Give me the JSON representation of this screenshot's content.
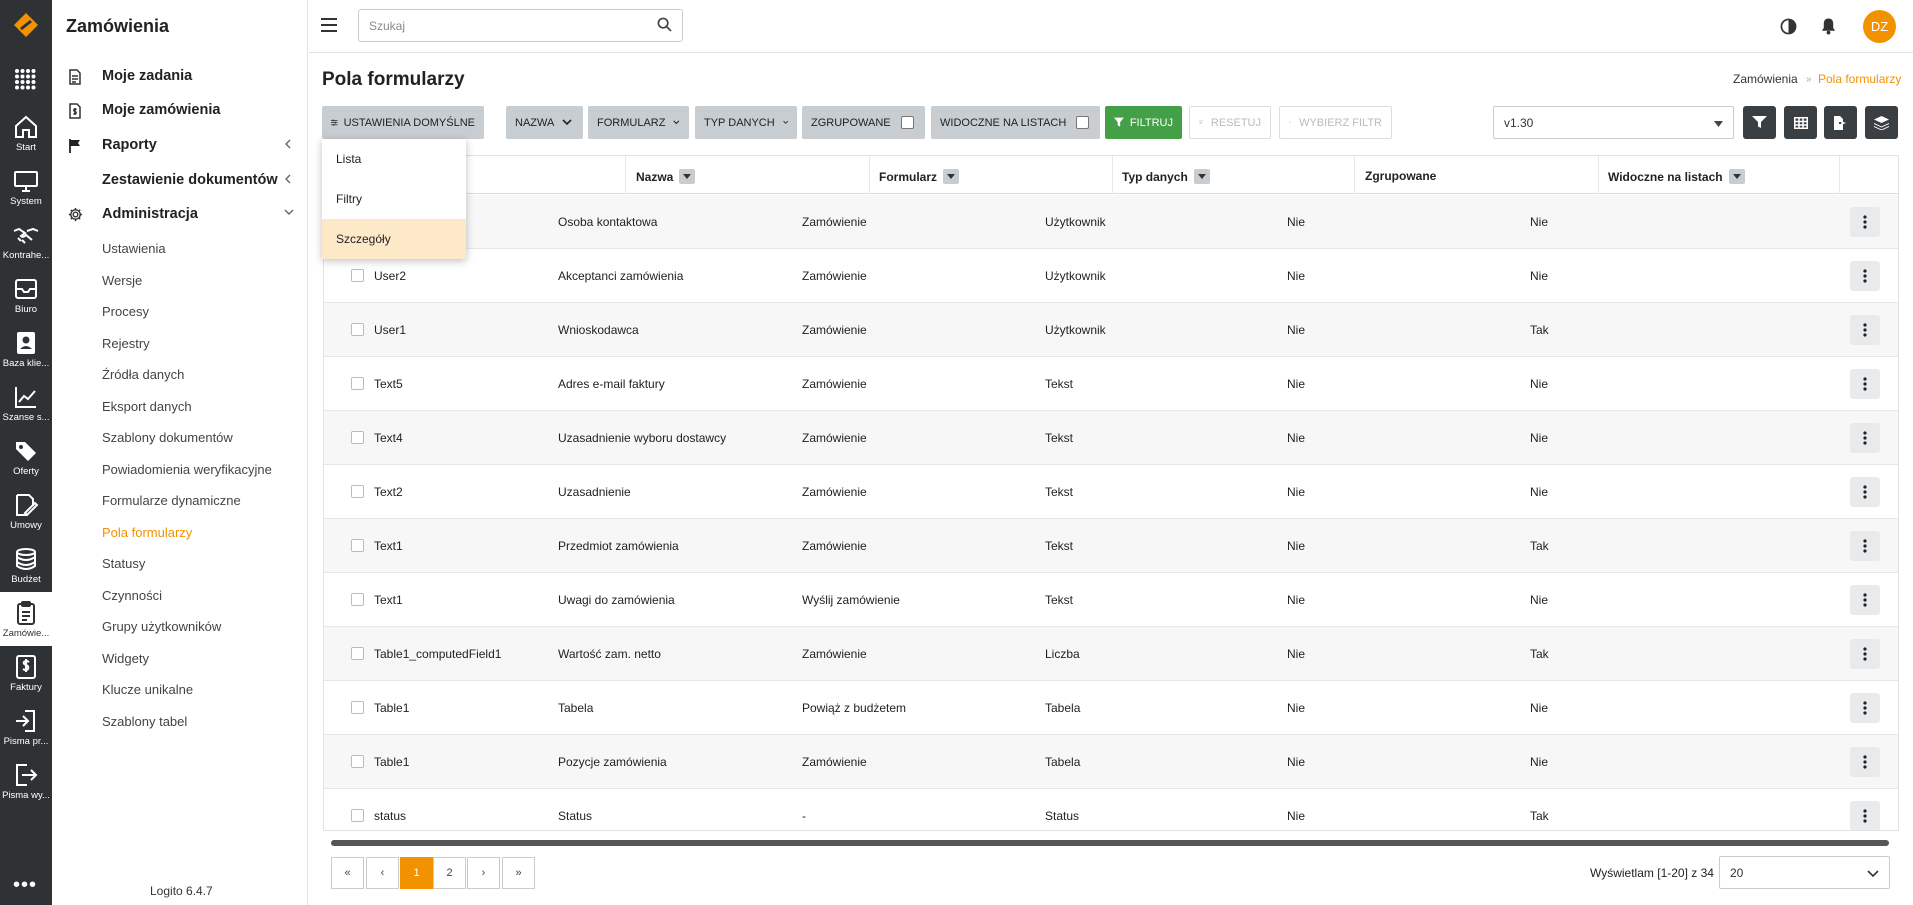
{
  "rail": {
    "items": [
      {
        "label": "Start",
        "icon": "home-icon"
      },
      {
        "label": "System",
        "icon": "monitor-icon"
      },
      {
        "label": "Kontrahe...",
        "icon": "handshake-icon"
      },
      {
        "label": "Biuro",
        "icon": "inbox-icon"
      },
      {
        "label": "Baza klie...",
        "icon": "contact-card-icon"
      },
      {
        "label": "Szanse s...",
        "icon": "chart-line-icon"
      },
      {
        "label": "Oferty",
        "icon": "tags-icon"
      },
      {
        "label": "Umowy",
        "icon": "signature-icon"
      },
      {
        "label": "Budżet",
        "icon": "coins-icon"
      },
      {
        "label": "Zamówie...",
        "icon": "clipboard-icon"
      },
      {
        "label": "Faktury",
        "icon": "invoice-icon"
      },
      {
        "label": "Pisma pr...",
        "icon": "sign-in-icon"
      },
      {
        "label": "Pisma wy...",
        "icon": "sign-out-icon"
      }
    ],
    "more": "•••"
  },
  "sidebar": {
    "title": "Zamówienia",
    "main": [
      {
        "label": "Moje zadania"
      },
      {
        "label": "Moje zamówienia"
      },
      {
        "label": "Raporty"
      },
      {
        "label": "Zestawienie dokumentów"
      },
      {
        "label": "Administracja"
      }
    ],
    "sub": [
      "Ustawienia",
      "Wersje",
      "Procesy",
      "Rejestry",
      "Źródła danych",
      "Eksport danych",
      "Szablony dokumentów",
      "Powiadomienia weryfikacyjne",
      "Formularze dynamiczne",
      "Pola formularzy",
      "Statusy",
      "Czynności",
      "Grupy użytkowników",
      "Widgety",
      "Klucze unikalne",
      "Szablony tabel"
    ],
    "active_sub": "Pola formularzy",
    "version": "Logito 6.4.7"
  },
  "topbar": {
    "search_placeholder": "Szukaj",
    "avatar": "DZ"
  },
  "page": {
    "title": "Pola formularzy",
    "breadcrumb": {
      "parent": "Zamówienia",
      "sep": "»",
      "current": "Pola formularzy"
    }
  },
  "toolbar": {
    "settings": "USTAWIENIA DOMYŚLNE",
    "nazwa": "NAZWA",
    "formularz": "FORMULARZ",
    "typ": "TYP DANYCH",
    "zgrupowane": "ZGRUPOWANE",
    "widoczne": "WIDOCZNE NA LISTACH",
    "filtruj": "FILTRUJ",
    "resetuj": "RESETUJ",
    "wybierz": "WYBIERZ FILTR",
    "version": "v1.30"
  },
  "dropdown": [
    "Lista",
    "Filtry",
    "Szczegóły"
  ],
  "table": {
    "headers": {
      "nazwa": "Nazwa",
      "formularz": "Formularz",
      "typ": "Typ danych",
      "zgrupowane": "Zgrupowane",
      "widoczne": "Widoczne na listach"
    },
    "rows": [
      [
        "",
        "Osoba kontaktowa",
        "Zamówienie",
        "Użytkownik",
        "Nie",
        "Nie"
      ],
      [
        "User2",
        "Akceptanci zamówienia",
        "Zamówienie",
        "Użytkownik",
        "Nie",
        "Nie"
      ],
      [
        "User1",
        "Wnioskodawca",
        "Zamówienie",
        "Użytkownik",
        "Nie",
        "Tak"
      ],
      [
        "Text5",
        "Adres e-mail faktury",
        "Zamówienie",
        "Tekst",
        "Nie",
        "Nie"
      ],
      [
        "Text4",
        "Uzasadnienie wyboru dostawcy",
        "Zamówienie",
        "Tekst",
        "Nie",
        "Nie"
      ],
      [
        "Text2",
        "Uzasadnienie",
        "Zamówienie",
        "Tekst",
        "Nie",
        "Nie"
      ],
      [
        "Text1",
        "Przedmiot zamówienia",
        "Zamówienie",
        "Tekst",
        "Nie",
        "Tak"
      ],
      [
        "Text1",
        "Uwagi do zamówienia",
        "Wyślij zamówienie",
        "Tekst",
        "Nie",
        "Nie"
      ],
      [
        "Table1_computedField1",
        "Wartość zam. netto",
        "Zamówienie",
        "Liczba",
        "Nie",
        "Tak"
      ],
      [
        "Table1",
        "Tabela",
        "Powiąż z budżetem",
        "Tabela",
        "Nie",
        "Nie"
      ],
      [
        "Table1",
        "Pozycje zamówienia",
        "Zamówienie",
        "Tabela",
        "Nie",
        "Nie"
      ],
      [
        "status",
        "Status",
        "-",
        "Status",
        "Nie",
        "Tak"
      ]
    ]
  },
  "pagination": {
    "first": "«",
    "prev": "‹",
    "pages": [
      "1",
      "2"
    ],
    "next": "›",
    "last": "»",
    "info": "Wyświetlam [1-20] z 34",
    "size": "20"
  },
  "colors": {
    "accent": "#f39200",
    "rail": "#2f3235",
    "filter_green": "#43a047"
  }
}
